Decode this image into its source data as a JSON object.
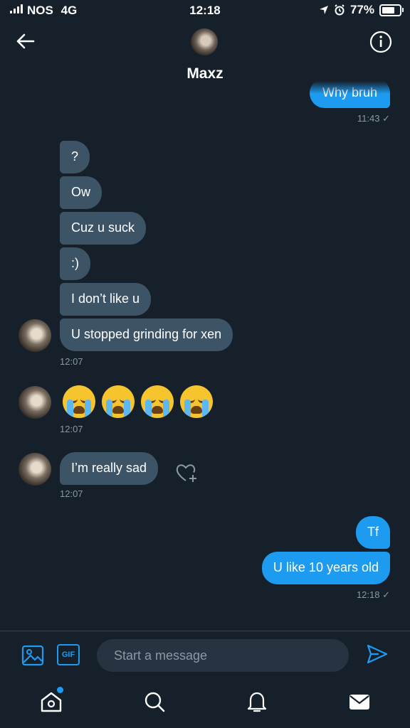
{
  "status_bar": {
    "carrier": "NOS",
    "network": "4G",
    "time": "12:18",
    "battery": "77%"
  },
  "header": {
    "name": "Maxz"
  },
  "messages": {
    "top_out_text": "Why bruh",
    "top_out_time": "11:43 ✓",
    "incoming_1": [
      "?",
      "Ow",
      "Cuz u suck",
      ":)",
      "I don’t like u",
      "U stopped grinding for xen"
    ],
    "incoming_1_time": "12:07",
    "emoji_time": "12:07",
    "incoming_2_text": "I’m really sad",
    "incoming_2_time": "12:07",
    "outgoing": [
      "Tf",
      "U like 10 years old"
    ],
    "outgoing_time": "12:18 ✓"
  },
  "composer": {
    "placeholder": "Start a message",
    "gif_label": "GIF"
  },
  "icons": {
    "back": "back-arrow-icon",
    "info": "info-icon",
    "media": "image-icon",
    "gif": "gif-icon",
    "send": "send-icon",
    "react": "heart-plus-icon",
    "tabs": [
      "home-icon",
      "search-icon",
      "notifications-icon",
      "messages-icon"
    ]
  },
  "colors": {
    "background": "#15202b",
    "incoming_bubble": "#3d5466",
    "outgoing_bubble": "#1d9bf0",
    "muted_text": "#8b98a5",
    "accent": "#1d9bf0"
  }
}
